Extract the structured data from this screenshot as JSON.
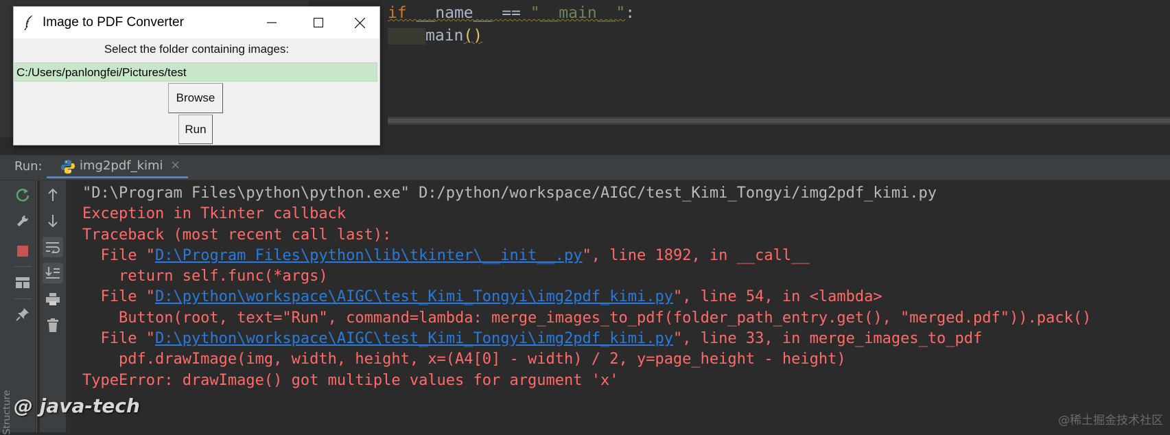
{
  "editor": {
    "line1": {
      "kw_if": "if",
      "name_var": "__name__",
      "op": "==",
      "str": "\"__main__\"",
      "colon": ":"
    },
    "line2": {
      "call": "main",
      "paren": "()"
    }
  },
  "tk_window": {
    "title": "Image to PDF Converter",
    "label": "Select the folder containing images:",
    "entry_value": "C:/Users/panlongfei/Pictures/test",
    "browse_label": "Browse",
    "run_label": "Run",
    "controls": {
      "minimize": "—",
      "maximize": "☐",
      "close": "✕"
    }
  },
  "run_panel": {
    "label": "Run:",
    "tab_name": "img2pdf_kimi",
    "tab_close": "×",
    "side_label": "Structure"
  },
  "console": {
    "line1": "\"D:\\Program Files\\python\\python.exe\" D:/python/workspace/AIGC/test_Kimi_Tongyi/img2pdf_kimi.py",
    "line2": "Exception in Tkinter callback",
    "line3": "Traceback (most recent call last):",
    "line4": {
      "pre": "  File \"",
      "link": "D:\\Program Files\\python\\lib\\tkinter\\__init__.py",
      "post": "\", line 1892, in __call__"
    },
    "line5": "    return self.func(*args)",
    "line6": {
      "pre": "  File \"",
      "link": "D:\\python\\workspace\\AIGC\\test_Kimi_Tongyi\\img2pdf_kimi.py",
      "post": "\", line 54, in <lambda>"
    },
    "line7": "    Button(root, text=\"Run\", command=lambda: merge_images_to_pdf(folder_path_entry.get(), \"merged.pdf\")).pack()",
    "line8": {
      "pre": "  File \"",
      "link": "D:\\python\\workspace\\AIGC\\test_Kimi_Tongyi\\img2pdf_kimi.py",
      "post": "\", line 33, in merge_images_to_pdf"
    },
    "line9": "    pdf.drawImage(img, width, height, x=(A4[0] - width) / 2, y=page_height - height)",
    "line10": "TypeError: drawImage() got multiple values for argument 'x'"
  },
  "toolbar_icons": [
    "rerun-icon",
    "wrench-icon",
    "stop-icon",
    "layout-icon",
    "pin-icon",
    "up-arrow-icon",
    "down-arrow-icon",
    "soft-wrap-icon",
    "scroll-to-end-icon",
    "print-icon",
    "trash-icon"
  ],
  "overlay": {
    "watermark": "@ java-tech",
    "corner_mark": "@稀土掘金技术社区"
  }
}
